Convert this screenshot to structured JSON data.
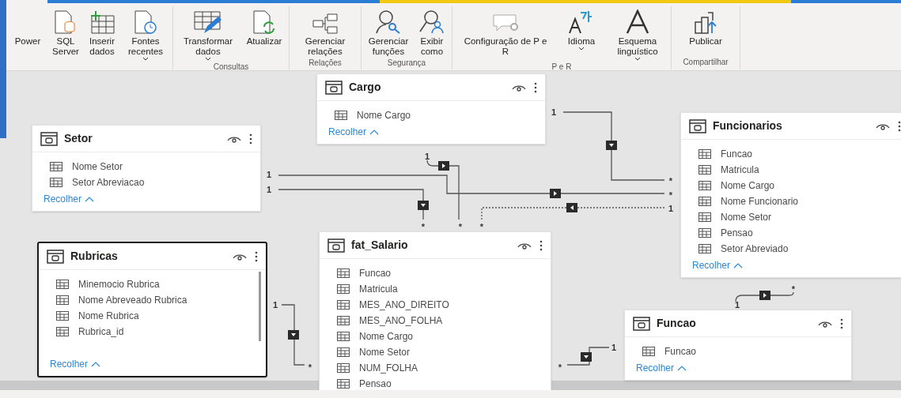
{
  "ribbon": {
    "groups": [
      {
        "buttons": [
          {
            "label": "Power",
            "dropdown": false
          },
          {
            "label": "SQL\nServer",
            "dropdown": false
          },
          {
            "label": "Inserir\ndados",
            "dropdown": false
          },
          {
            "label": "Fontes\nrecentes",
            "dropdown": true
          }
        ]
      },
      {
        "label": "Consultas",
        "buttons": [
          {
            "label": "Transformar\ndados",
            "dropdown": true
          },
          {
            "label": "Atualizar",
            "dropdown": false
          }
        ]
      },
      {
        "label": "Relações",
        "buttons": [
          {
            "label": "Gerenciar\nrelações",
            "dropdown": false
          }
        ]
      },
      {
        "label": "Segurança",
        "buttons": [
          {
            "label": "Gerenciar\nfunções",
            "dropdown": false
          },
          {
            "label": "Exibir\ncomo",
            "dropdown": false
          }
        ]
      },
      {
        "label": "P e R",
        "buttons": [
          {
            "label": "Configuração de P e\nR",
            "dropdown": false
          },
          {
            "label": "Idioma",
            "dropdown": true
          },
          {
            "label": "Esquema\nlinguístico",
            "dropdown": true
          }
        ]
      },
      {
        "label": "Compartilhar",
        "buttons": [
          {
            "label": "Publicar",
            "dropdown": false
          }
        ]
      }
    ]
  },
  "tables": [
    {
      "name": "Cargo",
      "selected": false,
      "fields": [
        "Nome Cargo"
      ],
      "collapse_link": "Recolher"
    },
    {
      "name": "Setor",
      "selected": false,
      "fields": [
        "Nome Setor",
        "Setor Abreviacao"
      ],
      "collapse_link": "Recolher"
    },
    {
      "name": "Rubricas",
      "selected": true,
      "fields": [
        "Minemocio Rubrica",
        "Nome Abreveado Rubrica",
        "Nome Rubrica",
        "Rubrica_id"
      ],
      "collapse_link": "Recolher"
    },
    {
      "name": "fat_Salario",
      "selected": false,
      "fields": [
        "Funcao",
        "Matricula",
        "MES_ANO_DIREITO",
        "MES_ANO_FOLHA",
        "Nome Cargo",
        "Nome Setor",
        "NUM_FOLHA",
        "Pensao"
      ]
    },
    {
      "name": "Funcionarios",
      "selected": false,
      "fields": [
        "Funcao",
        "Matricula",
        "Nome Cargo",
        "Nome Funcionario",
        "Nome Setor",
        "Pensao",
        "Setor Abreviado"
      ],
      "collapse_link": "Recolher"
    },
    {
      "name": "Funcao",
      "selected": false,
      "fields": [
        "Funcao"
      ],
      "collapse_link": "Recolher"
    }
  ],
  "relationships": [
    {
      "one": "1",
      "many": "*",
      "active": true
    },
    {
      "one": "1",
      "many": "*",
      "active": true
    },
    {
      "one": "1",
      "many": "*",
      "active": true
    },
    {
      "one": "1",
      "many": "*",
      "active": true
    },
    {
      "one": "1",
      "many": "*",
      "active": false
    },
    {
      "one": "1",
      "many": "*",
      "active": true
    },
    {
      "one": "1",
      "many": "*",
      "active": true
    },
    {
      "one": "1",
      "many": "*",
      "active": true
    }
  ]
}
